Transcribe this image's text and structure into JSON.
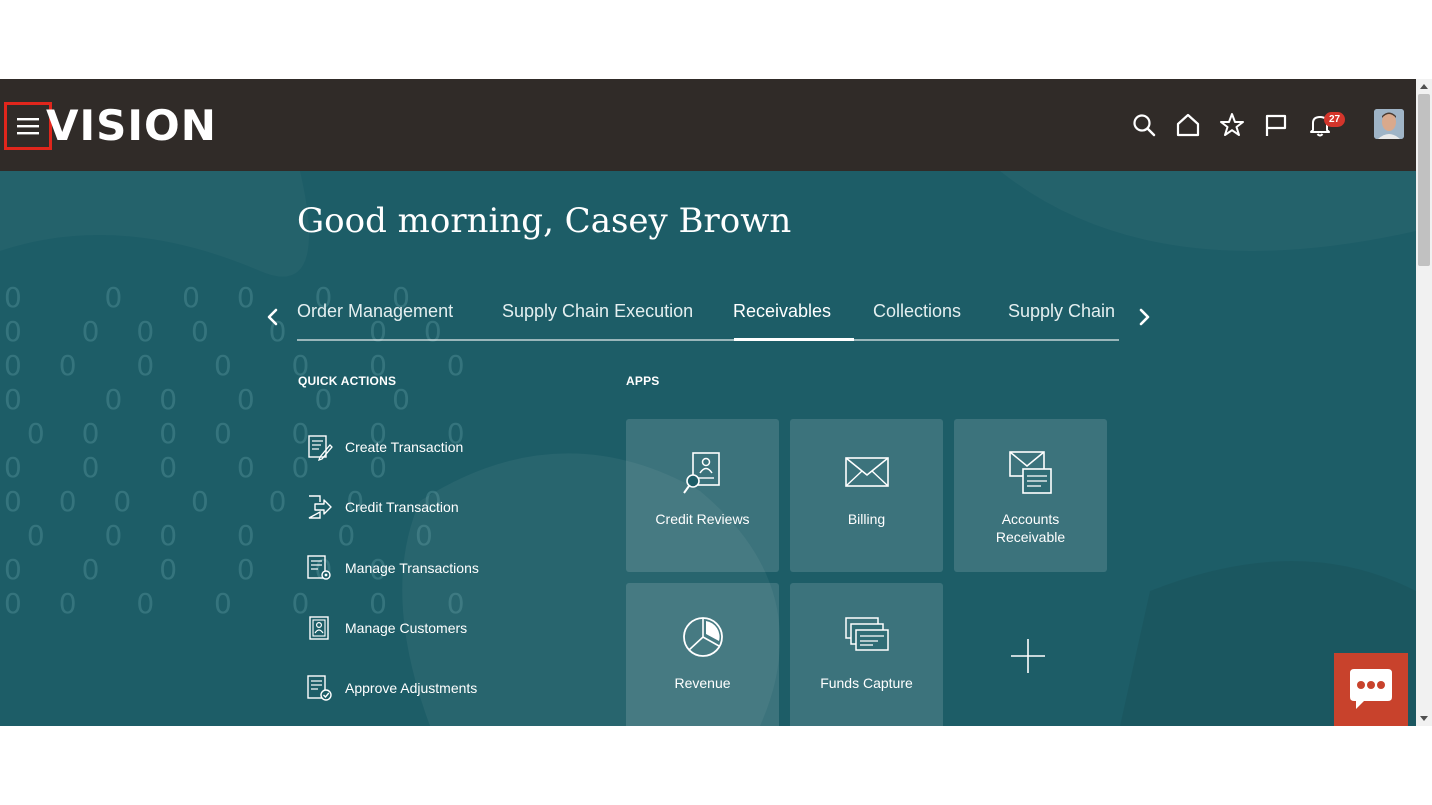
{
  "app": {
    "logo": "VISION"
  },
  "header": {
    "icons": [
      "search-icon",
      "home-icon",
      "star-icon",
      "flag-icon",
      "bell-icon",
      "avatar"
    ],
    "notification_count": "27"
  },
  "greeting": "Good morning, Casey Brown",
  "tabs": [
    {
      "label": "Order Management",
      "active": false
    },
    {
      "label": "Supply Chain Execution",
      "active": false
    },
    {
      "label": "Receivables",
      "active": true
    },
    {
      "label": "Collections",
      "active": false
    },
    {
      "label": "Supply Chain F",
      "active": false
    }
  ],
  "quick_actions": {
    "heading": "QUICK ACTIONS",
    "items": [
      {
        "label": "Create Transaction",
        "icon": "create-transaction-icon"
      },
      {
        "label": "Credit Transaction",
        "icon": "credit-transaction-icon"
      },
      {
        "label": "Manage Transactions",
        "icon": "manage-transactions-icon"
      },
      {
        "label": "Manage Customers",
        "icon": "manage-customers-icon"
      },
      {
        "label": "Approve Adjustments",
        "icon": "approve-adjustments-icon"
      }
    ]
  },
  "apps": {
    "heading": "APPS",
    "tiles": [
      {
        "label": "Credit Reviews",
        "icon": "credit-reviews-icon"
      },
      {
        "label": "Billing",
        "icon": "envelope-icon"
      },
      {
        "label_line1": "Accounts",
        "label_line2": "Receivable",
        "icon": "accounts-receivable-icon"
      },
      {
        "label": "Revenue",
        "icon": "pie-chart-icon"
      },
      {
        "label": "Funds Capture",
        "icon": "funds-capture-icon"
      }
    ]
  },
  "colors": {
    "topbar": "#302b28",
    "hero": "#1d5d67",
    "highlight": "#e0261c",
    "chat": "#c8422c",
    "badge": "#d3352b"
  }
}
